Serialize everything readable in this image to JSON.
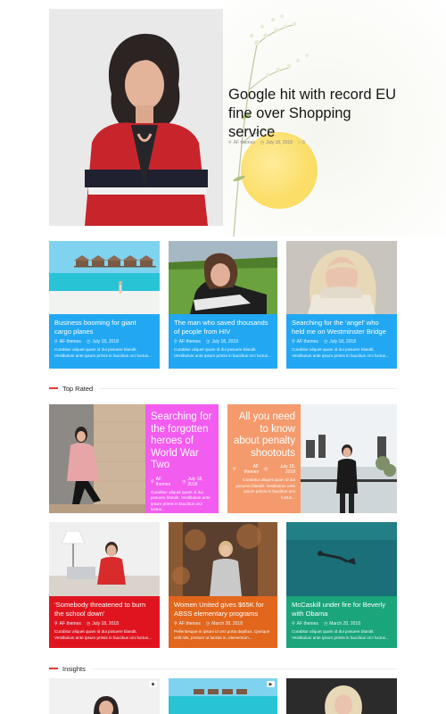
{
  "hero": {
    "title": "Google hit with record EU fine over Shopping service",
    "author": "AF themes",
    "date": "July 18, 2018",
    "comments": "0"
  },
  "row1": [
    {
      "title": "Business booming for giant cargo planes",
      "author": "AF themes",
      "date": "July 18, 2018",
      "excerpt": "Curabitur aliquet quam id dui posuere blandit. Vestibulum ante ipsum primis in faucibus orci luctus..."
    },
    {
      "title": "The man who saved thousands of people from HIV",
      "author": "AF themes",
      "date": "July 18, 2018",
      "excerpt": "Curabitur aliquet quam id dui posuere blandit. Vestibulum ante ipsum primis in faucibus orci luctus..."
    },
    {
      "title": "Searching for the ‘angel’ who held me on Westminster Bridge",
      "author": "AF themes",
      "date": "July 18, 2018",
      "excerpt": "Curabitur aliquet quam id dui posuere blandit. Vestibulum ante ipsum primis in faucibus orci luctus..."
    }
  ],
  "sections": {
    "top_rated": "Top Rated",
    "insights": "Insights"
  },
  "top_rated": [
    {
      "title": "Searching for the forgotten heroes of World War Two",
      "author": "AF themes",
      "date": "July 18, 2018",
      "excerpt": "Curabitur aliquet quam id dui posuere blandit. Vestibulum ante ipsum primis in faucibus orci luctus...",
      "color": "#f25cef"
    },
    {
      "title": "All you need to know about penalty shootouts",
      "author": "AF themes",
      "date": "July 18, 2018",
      "excerpt": "Curabitur aliquet quam id dui posuere blandit. Vestibulum ante ipsum primis in faucibus orci luctus...",
      "color": "#f49a6c"
    }
  ],
  "row3": [
    {
      "title": "‘Somebody threatened to burn the school down’",
      "author": "AF themes",
      "date": "July 18, 2018",
      "excerpt": "Curabitur aliquet quam id dui posuere blandit. Vestibulum ante ipsum primis in faucibus orci luctus...",
      "color": "#e0141f"
    },
    {
      "title": "Women United gives $65K for ABSS elementary programs",
      "author": "AF themes",
      "date": "March 28, 2018",
      "excerpt": "Pellentesque in ipsum id orci porta dapibus. Quisque velit nisi, pretium ut lacinia in, elementum...",
      "color": "#e2661c"
    },
    {
      "title": "McCaskill under fire for Beverly with Obama",
      "author": "AF themes",
      "date": "March 28, 2018",
      "excerpt": "Curabitur aliquet quam id dui posuere blandit. Vestibulum ante ipsum primis in faucibus orci luctus...",
      "color": "#1aa57a"
    }
  ],
  "colors": {
    "card_blue": "#22a8f2",
    "accent_red": "#e53935"
  }
}
